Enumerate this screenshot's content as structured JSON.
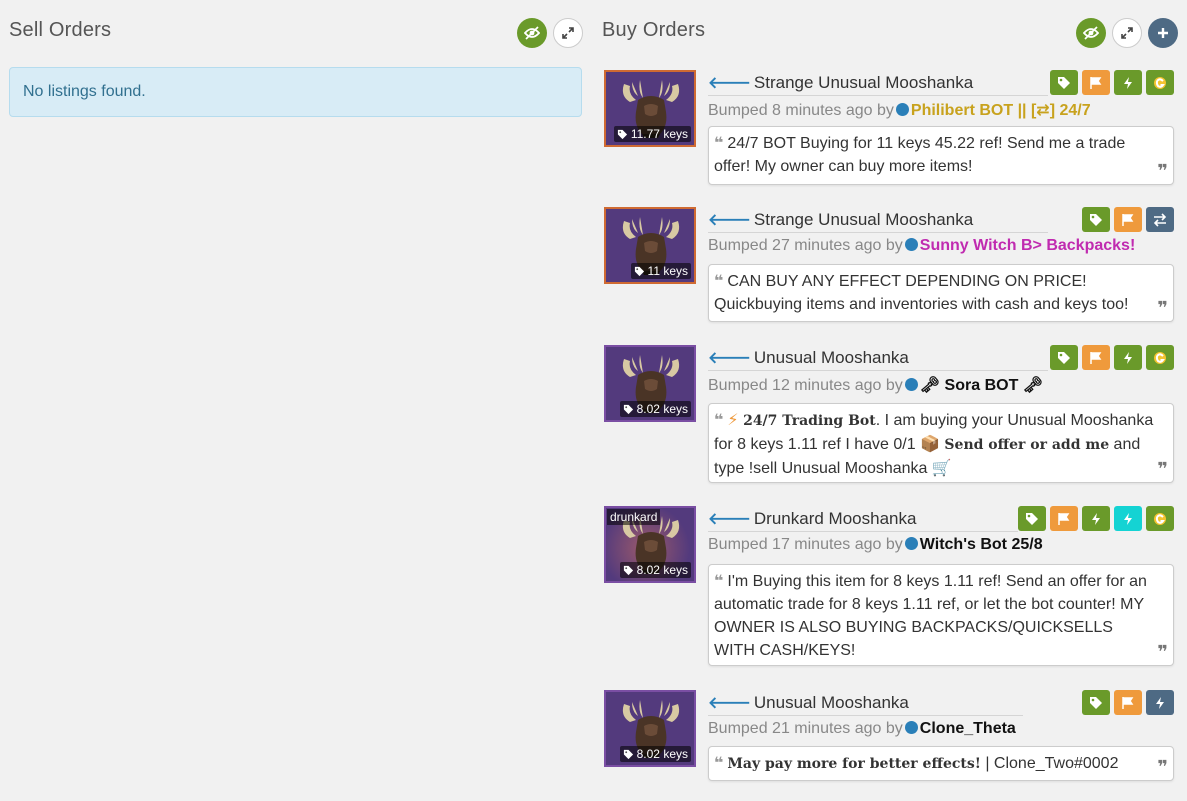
{
  "sell": {
    "title": "Sell Orders",
    "empty_text": "No listings found."
  },
  "buy": {
    "title": "Buy Orders",
    "listings": [
      {
        "title": "Strange Unusual Mooshanka",
        "price": "11.77 keys",
        "bumped_prefix": "Bumped 8 minutes ago by",
        "user": "Philibert BOT || [⇄] 24/7",
        "user_color": "#c8a21d",
        "message": "24/7 BOT Buying for 11 keys 45.22 ref! Send me a trade offer! My owner can buy more items!",
        "badges": [
          "tag-icon",
          "flag-icon",
          "lightning-icon",
          "gladiator-icon"
        ]
      },
      {
        "title": "Strange Unusual Mooshanka",
        "price": "11 keys",
        "bumped_prefix": "Bumped 27 minutes ago by",
        "user": "Sunny Witch B> Backpacks!",
        "user_color": "#c02bb0",
        "message": "CAN BUY ANY EFFECT DEPENDING ON PRICE! Quickbuying items and inventories with cash and keys too!",
        "badges": [
          "tag-icon",
          "flag-icon",
          "exchange-icon"
        ]
      },
      {
        "title": "Unusual Mooshanka",
        "price": "8.02 keys",
        "bumped_prefix": "Bumped 12 minutes ago by",
        "user": "🗝 Sora BOT 🗝",
        "user_color": "#111111",
        "message_parts": {
          "emoji1": "⚡",
          "bold1": "24/7 Trading Bot",
          "text1": ". I am buying your Unusual Mooshanka for 8 keys 1.11 ref I have 0/1 ",
          "emoji2": "📦",
          "bold2": "Send offer or add me",
          "text2": " and type !sell Unusual Mooshanka ",
          "emoji3": "🛒"
        },
        "badges": [
          "tag-icon",
          "flag-icon",
          "lightning-icon",
          "gladiator-icon"
        ]
      },
      {
        "title": "Drunkard Mooshanka",
        "effect": "drunkard",
        "price": "8.02 keys",
        "bumped_prefix": "Bumped 17 minutes ago by",
        "user": "Witch's Bot 25/8",
        "user_color": "#111111",
        "message": "I'm Buying this item for 8 keys 1.11 ref! Send an offer for an automatic trade for 8 keys 1.11 ref, or let the bot counter! MY OWNER IS ALSO BUYING BACKPACKS/QUICKSELLS WITH CASH/KEYS!",
        "badges": [
          "tag-icon",
          "flag-icon",
          "lightning-icon",
          "lightning-cyan-icon",
          "gladiator-icon"
        ]
      },
      {
        "title": "Unusual Mooshanka",
        "price": "8.02 keys",
        "bumped_prefix": "Bumped 21 minutes ago by",
        "user": "Clone_Theta",
        "user_color": "#111111",
        "message_parts": {
          "bold1": "May pay more for better effects!",
          "text1": " | Clone_Two#0002"
        },
        "badges": [
          "tag-icon",
          "flag-icon",
          "lightning-slate-icon"
        ]
      }
    ]
  },
  "colors": {
    "green": "#6a9a2a",
    "orange": "#ef9a3c",
    "slate": "#4e6a84",
    "cyan": "#14d3d3",
    "info_bg": "#d8ecf6",
    "link_blue": "#2a7fb8"
  }
}
